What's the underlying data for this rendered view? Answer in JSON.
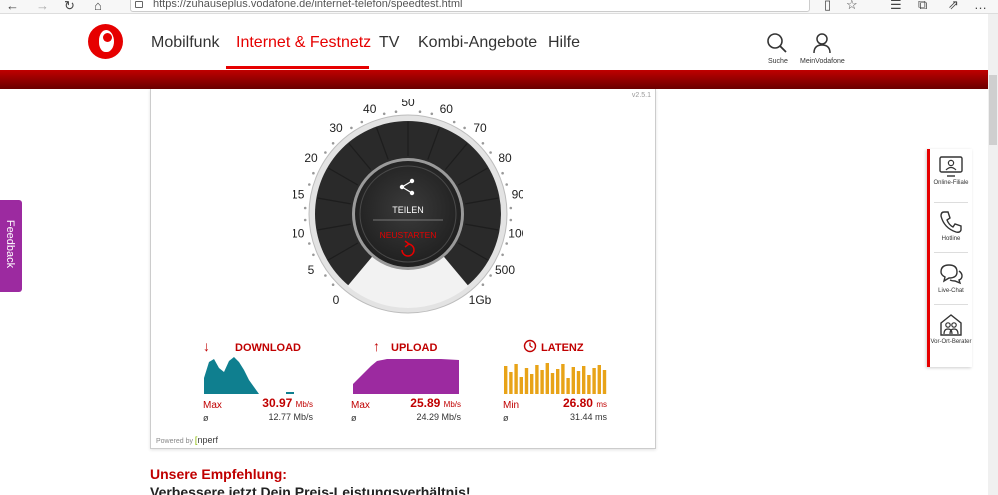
{
  "browser": {
    "url": "https://zuhauseplus.vodafone.de/internet-telefon/speedtest.html"
  },
  "header": {
    "nav": [
      {
        "label": "Mobilfunk",
        "active": false
      },
      {
        "label": "Internet & Festnetz",
        "active": true
      },
      {
        "label": "TV",
        "active": false
      },
      {
        "label": "Kombi-Angebote",
        "active": false
      },
      {
        "label": "Hilfe",
        "active": false
      }
    ],
    "search_label": "Suche",
    "account_label": "MeinVodafone",
    "brand_color": "#e60000"
  },
  "feedback_label": "Feedback",
  "speedtest": {
    "version": "v2.5.1",
    "gauge": {
      "scale_labels": [
        "0",
        "5",
        "10",
        "15",
        "20",
        "30",
        "40",
        "50",
        "60",
        "70",
        "80",
        "90",
        "100",
        "500",
        "1Gb"
      ],
      "share_label": "TEILEN",
      "restart_label": "NEUSTARTEN",
      "progress_fraction": 0.09
    },
    "download": {
      "title": "DOWNLOAD",
      "max_label": "Max",
      "max_value": "30.97",
      "unit": "Mb/s",
      "avg_symbol": "ø",
      "avg_value": "12.77 Mb/s",
      "color": "#0f7f8f"
    },
    "upload": {
      "title": "UPLOAD",
      "max_label": "Max",
      "max_value": "25.89",
      "unit": "Mb/s",
      "avg_symbol": "ø",
      "avg_value": "24.29 Mb/s",
      "color": "#9c2aa0"
    },
    "latency": {
      "title": "LATENZ",
      "min_label": "Min",
      "min_value": "26.80",
      "unit": "ms",
      "avg_symbol": "ø",
      "avg_value": "31.44 ms",
      "color": "#e8a317"
    },
    "powered_by": "Powered by",
    "powered_brand": "nperf"
  },
  "recommendation": {
    "title": "Unsere Empfehlung:",
    "subtitle": "Verbessere jetzt Dein Preis-Leistungsverhältnis!"
  },
  "service_panel": [
    {
      "label": "Online-Filiale",
      "icon": "online-store-icon"
    },
    {
      "label": "Hotline",
      "icon": "phone-icon"
    },
    {
      "label": "Live-Chat",
      "icon": "chat-icon"
    },
    {
      "label": "Vor-Ort-Berater",
      "icon": "local-advisor-icon"
    }
  ]
}
